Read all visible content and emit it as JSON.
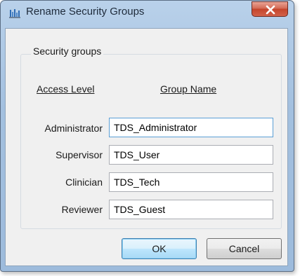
{
  "window": {
    "title": "Rename Security Groups"
  },
  "colors": {
    "accent": "#3c7fb1",
    "close_button": "#c4452c"
  },
  "icons": {
    "app": "app-icon",
    "close": "close-icon"
  },
  "group": {
    "legend": "Security groups",
    "headers": {
      "access_level": "Access Level",
      "group_name": "Group Name"
    },
    "rows": [
      {
        "access_level": "Administrator",
        "group_name": "TDS_Administrator"
      },
      {
        "access_level": "Supervisor",
        "group_name": "TDS_User"
      },
      {
        "access_level": "Clinician",
        "group_name": "TDS_Tech"
      },
      {
        "access_level": "Reviewer",
        "group_name": "TDS_Guest"
      }
    ]
  },
  "buttons": {
    "ok": "OK",
    "cancel": "Cancel"
  }
}
